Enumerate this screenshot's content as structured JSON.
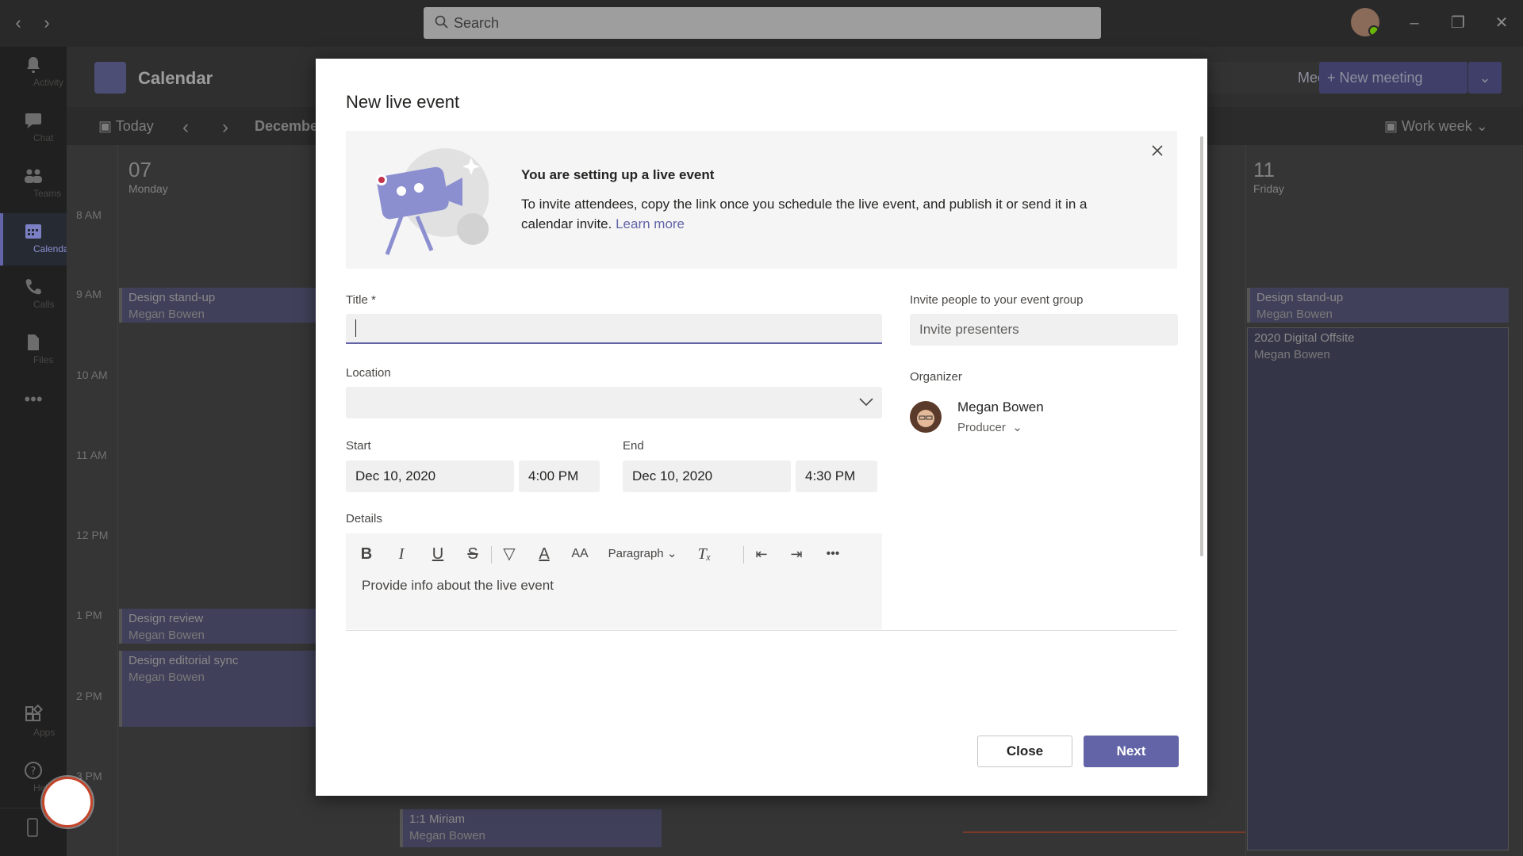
{
  "titlebar": {
    "search_placeholder": "Search"
  },
  "rail": {
    "items": [
      {
        "label": "Activity",
        "icon": "bell-icon"
      },
      {
        "label": "Chat",
        "icon": "chat-icon"
      },
      {
        "label": "Teams",
        "icon": "teams-icon"
      },
      {
        "label": "Calendar",
        "icon": "calendar-icon"
      },
      {
        "label": "Calls",
        "icon": "phone-icon"
      },
      {
        "label": "Files",
        "icon": "file-icon"
      },
      {
        "label": "Apps",
        "icon": "apps-icon"
      },
      {
        "label": "Help",
        "icon": "help-icon"
      }
    ]
  },
  "calendar": {
    "title": "Calendar",
    "today": "Today",
    "month": "December",
    "meet_now": "Meet now",
    "new_meeting": "New meeting",
    "view": "Work week",
    "times": [
      "8 AM",
      "9 AM",
      "10 AM",
      "11 AM",
      "12 PM",
      "1 PM",
      "2 PM",
      "3 PM"
    ],
    "days": [
      {
        "num": "07",
        "name": "Monday"
      },
      {
        "num": "11",
        "name": "Friday"
      }
    ],
    "events": [
      {
        "title": "Design stand-up",
        "person": "Megan Bowen"
      },
      {
        "title": "Design review",
        "person": "Megan Bowen"
      },
      {
        "title": "Design editorial sync",
        "person": "Megan Bowen"
      },
      {
        "title": "1:1 Miriam",
        "person": "Megan Bowen"
      },
      {
        "title": "Design stand-up",
        "person": "Megan Bowen"
      },
      {
        "title": "2020 Digital Offsite",
        "person": "Megan Bowen"
      }
    ]
  },
  "dialog": {
    "title": "New live event",
    "banner": {
      "heading": "You are setting up a live event",
      "body": "To invite attendees, copy the link once you schedule the live event, and publish it or send it in a calendar invite.",
      "link": "Learn more"
    },
    "title_label": "Title *",
    "title_value": "",
    "location_label": "Location",
    "location_value": "",
    "start_label": "Start",
    "start_date": "Dec 10, 2020",
    "start_time": "4:00 PM",
    "end_label": "End",
    "end_date": "Dec 10, 2020",
    "end_time": "4:30 PM",
    "details_label": "Details",
    "details_placeholder": "Provide info about the live event",
    "format_paragraph": "Paragraph",
    "invite_label": "Invite people to your event group",
    "invite_placeholder": "Invite presenters",
    "organizer_label": "Organizer",
    "organizer_name": "Megan Bowen",
    "organizer_role": "Producer",
    "close_button": "Close",
    "next_button": "Next"
  },
  "colors": {
    "accent": "#6264a7",
    "record_ring": "#c4452a"
  }
}
